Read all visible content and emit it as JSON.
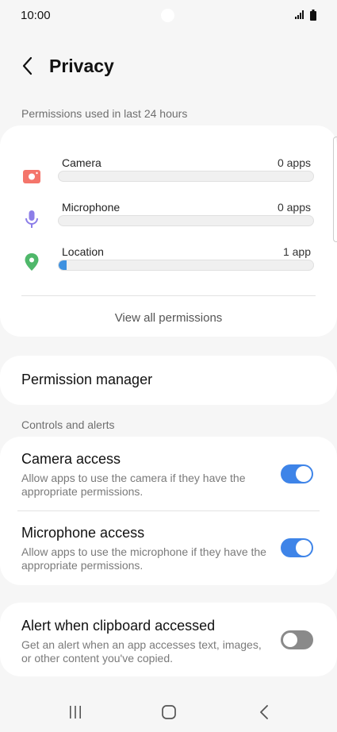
{
  "status_bar": {
    "time": "10:00"
  },
  "header": {
    "title": "Privacy"
  },
  "permissions_section": {
    "label": "Permissions used in last 24 hours",
    "items": [
      {
        "name": "Camera",
        "count": "0 apps",
        "usage_fraction": 0,
        "icon": "camera-icon",
        "color": "#f4756b"
      },
      {
        "name": "Microphone",
        "count": "0 apps",
        "usage_fraction": 0,
        "icon": "microphone-icon",
        "color": "#8c7ee8"
      },
      {
        "name": "Location",
        "count": "1 app",
        "usage_fraction": 0.03,
        "icon": "location-pin-icon",
        "color": "#4fb86a"
      }
    ],
    "view_all_label": "View all permissions"
  },
  "permission_manager": {
    "label": "Permission manager"
  },
  "controls_section": {
    "label": "Controls and alerts",
    "items": [
      {
        "title": "Camera access",
        "description": "Allow apps to use the camera if they have the appropriate permissions.",
        "enabled": true
      },
      {
        "title": "Microphone access",
        "description": "Allow apps to use the microphone if they have the appropriate permissions.",
        "enabled": true
      }
    ]
  },
  "clipboard_alert": {
    "title": "Alert when clipboard accessed",
    "description": "Get an alert when an app accesses text, images, or other content you've copied.",
    "enabled": false
  },
  "colors": {
    "accent": "#3e84e8",
    "background": "#f6f6f6",
    "card": "#ffffff"
  }
}
